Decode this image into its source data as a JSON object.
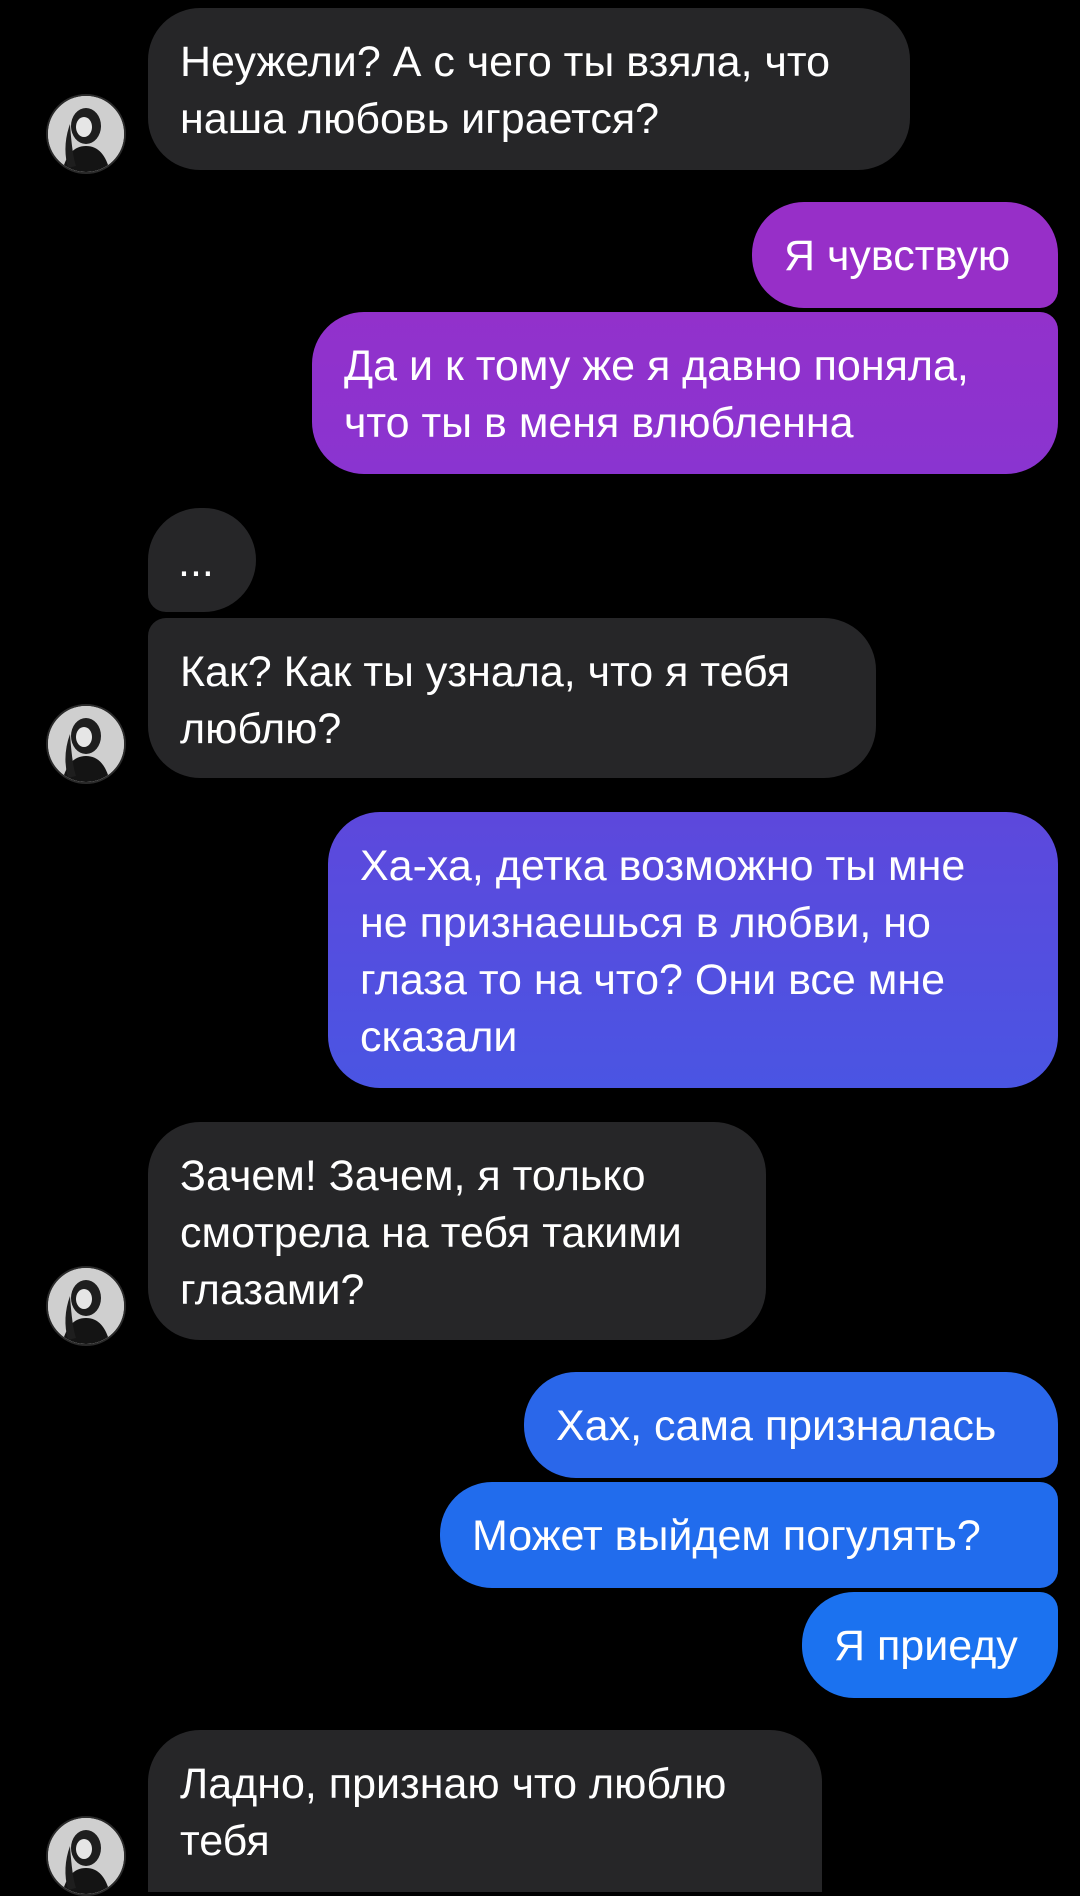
{
  "conversation": {
    "messages": [
      {
        "id": "m1",
        "sender": "them",
        "text": "Неужели? А с чего ты взяла, что\nнаша любовь играется?"
      },
      {
        "id": "m2",
        "sender": "me",
        "text": "Я чувствую"
      },
      {
        "id": "m3",
        "sender": "me",
        "text": "Да и к тому же я давно поняла,\nчто ты в меня влюбленна"
      },
      {
        "id": "m4",
        "sender": "them",
        "text": "..."
      },
      {
        "id": "m5",
        "sender": "them",
        "text": "Как? Как ты узнала, что я тебя\nлюблю?"
      },
      {
        "id": "m6",
        "sender": "me",
        "text": "Ха-ха, детка возможно ты мне\nне признаешься в любви, но\nглаза то на что? Они все мне\nсказали"
      },
      {
        "id": "m7",
        "sender": "them",
        "text": "Зачем! Зачем, я только\nсмотрела на тебя такими\nглазами?"
      },
      {
        "id": "m8",
        "sender": "me",
        "text": "Хах, сама призналась"
      },
      {
        "id": "m9",
        "sender": "me",
        "text": "Может выйдем погулять?"
      },
      {
        "id": "m10",
        "sender": "me",
        "text": "Я приеду"
      },
      {
        "id": "m11",
        "sender": "them",
        "text": "Ладно, признаю что люблю\nтебя"
      }
    ]
  },
  "colors": {
    "background": "#000000",
    "incoming_bubble": "#262628",
    "outgoing_gradient_top": "#9b33c9",
    "outgoing_gradient_mid": "#5b4bdf",
    "outgoing_gradient_bottom": "#1a72f0",
    "text": "#ffffff"
  },
  "icons": {
    "avatar": "contact-avatar"
  }
}
